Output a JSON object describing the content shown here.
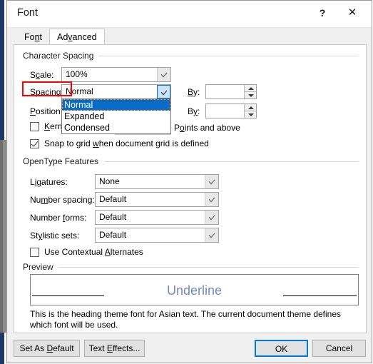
{
  "window": {
    "title": "Font",
    "help_icon": "question-mark-icon",
    "close_icon": "close-x-icon",
    "help_label": "?",
    "close_label": "✕"
  },
  "tabs": [
    {
      "label_pre": "Fo",
      "label_accel": "n",
      "label_post": "t",
      "active": false,
      "name": "tab-font"
    },
    {
      "label_pre": "Ad",
      "label_accel": "v",
      "label_post": "anced",
      "active": true,
      "name": "tab-advanced"
    }
  ],
  "character_spacing": {
    "group_label": "Character Spacing",
    "scale": {
      "label_pre": "S",
      "label_accel": "c",
      "label_post": "ale:",
      "value": "100%"
    },
    "spacing": {
      "label_pre": "",
      "label_accel": "S",
      "label_post": "pacing:",
      "value": "Normal",
      "highlighted": true,
      "options": [
        "Normal",
        "Expanded",
        "Condensed"
      ],
      "selected_option": "Normal"
    },
    "spacing_by": {
      "label_pre": "",
      "label_accel": "B",
      "label_post": "y:",
      "value": ""
    },
    "position": {
      "label_pre": "",
      "label_accel": "P",
      "label_post": "osition:",
      "value": ""
    },
    "position_by": {
      "label_pre": "B",
      "label_accel": "y",
      "label_post": ":",
      "value": ""
    },
    "kerning": {
      "label_pre": "",
      "label_accel": "K",
      "label_post": "erning for fonts:",
      "checked": false,
      "value": "",
      "suffix_pre": "P",
      "suffix_accel": "o",
      "suffix_post": "ints and above"
    },
    "snap_to_grid": {
      "label_pre": "Snap to grid ",
      "label_accel": "w",
      "label_post": "hen document grid is defined",
      "checked": true
    }
  },
  "opentype": {
    "group_label": "OpenType Features",
    "ligatures": {
      "label_pre": "L",
      "label_accel": "i",
      "label_post": "gatures:",
      "value": "None"
    },
    "number_spacing": {
      "label_pre": "Nu",
      "label_accel": "m",
      "label_post": "ber spacing:",
      "value": "Default"
    },
    "number_forms": {
      "label_pre": "Number ",
      "label_accel": "f",
      "label_post": "orms:",
      "value": "Default"
    },
    "stylistic_sets": {
      "label_pre": "St",
      "label_accel": "y",
      "label_post": "listic sets:",
      "value": "Default"
    },
    "contextual_alternates": {
      "label_pre": "Use Contextual ",
      "label_accel": "A",
      "label_post": "lternates",
      "checked": false
    }
  },
  "preview": {
    "group_label": "Preview",
    "sample_text": "Underline",
    "sample_color": "#7389b8",
    "description": "This is the heading theme font for Asian text. The current document theme defines which font will be used."
  },
  "footer": {
    "set_as_default": {
      "label_pre": "Set As ",
      "label_accel": "D",
      "label_post": "efault"
    },
    "text_effects": {
      "label_pre": "Text ",
      "label_accel": "E",
      "label_post": "ffects..."
    },
    "ok": {
      "label": "OK",
      "focused": true
    },
    "cancel": {
      "label": "Cancel",
      "focused": false
    }
  },
  "colors": {
    "highlight_red": "#ff0000",
    "focus_blue": "#0078d7",
    "dropdown_selected": "#0a6cc4"
  }
}
